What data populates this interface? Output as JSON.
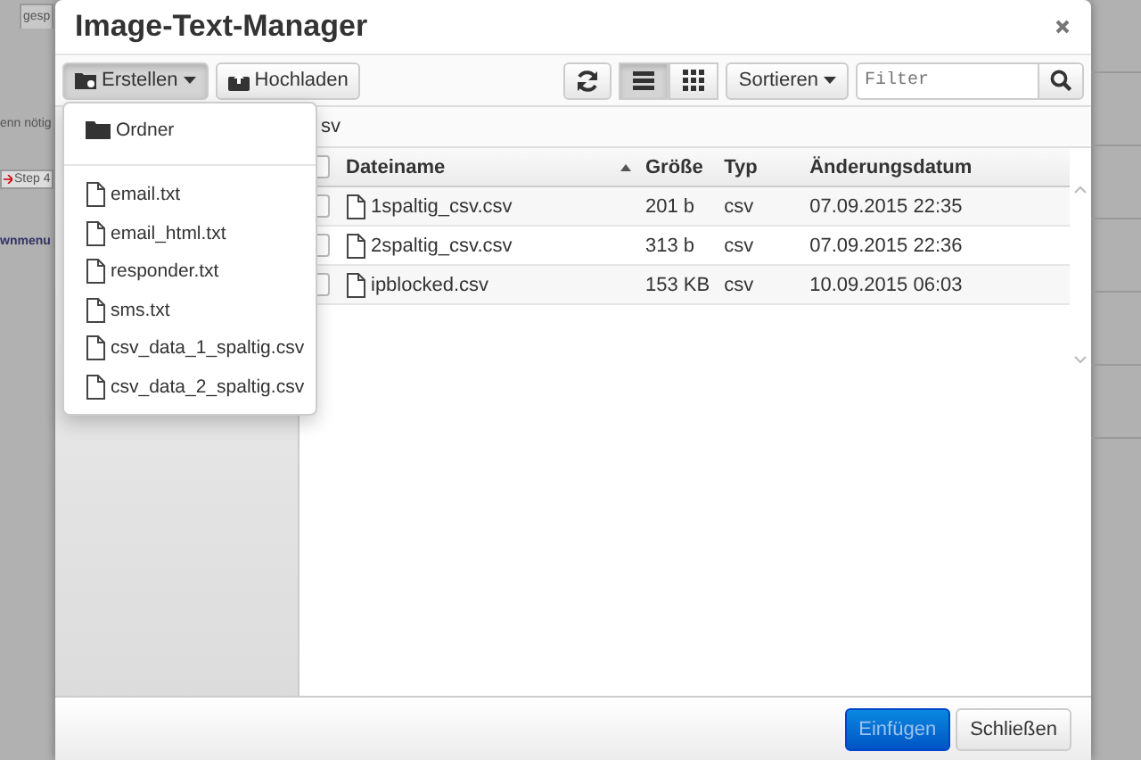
{
  "background": {
    "tab": "gesp",
    "texts": [
      {
        "kind": "hint",
        "text": "enn nötig"
      },
      {
        "kind": "step",
        "text": "Step 4"
      },
      {
        "kind": "link",
        "text": "wnmenu"
      }
    ]
  },
  "window": {
    "title": "Image-Text-Manager"
  },
  "toolbar": {
    "create_button": "Erstellen",
    "upload_button": "Hochladen",
    "views": [
      {
        "kind": "list",
        "selected": true
      },
      {
        "kind": "grid",
        "selected": false
      }
    ],
    "sort_button": "Sortieren",
    "filter": {
      "placeholder": "Filter"
    }
  },
  "create_menu": {
    "items": [
      {
        "kind": "folder",
        "label": "Ordner"
      },
      {
        "kind": "divider"
      },
      {
        "kind": "file",
        "label": "email.txt"
      },
      {
        "kind": "file",
        "label": "email_html.txt"
      },
      {
        "kind": "file",
        "label": "responder.txt"
      },
      {
        "kind": "file",
        "label": "sms.txt"
      },
      {
        "kind": "file",
        "label": "csv_data_1_spaltig.csv"
      },
      {
        "kind": "file",
        "label": "csv_data_2_spaltig.csv"
      }
    ]
  },
  "breadcrumb": "sv",
  "table": {
    "select_all_checked": false,
    "columns": [
      {
        "label": "Dateiname",
        "sorted": true
      },
      {
        "label": "Größe",
        "sorted": false
      },
      {
        "label": "Typ",
        "sorted": false
      },
      {
        "label": "Änderungsdatum",
        "sorted": false
      }
    ],
    "rows": [
      {
        "name": "1spaltig_csv.csv",
        "size": "201 b",
        "type": "csv",
        "modified": "07.09.2015 22:35",
        "checked": false
      },
      {
        "name": "2spaltig_csv.csv",
        "size": "313 b",
        "type": "csv",
        "modified": "07.09.2015 22:36",
        "checked": false
      },
      {
        "name": "ipblocked.csv",
        "size": "153 KB",
        "type": "csv",
        "modified": "10.09.2015 06:03",
        "checked": false
      }
    ]
  },
  "footer": {
    "buttons": [
      {
        "kind": "primary",
        "label": "Einfügen",
        "disabled": true
      },
      {
        "kind": "default",
        "label": "Schließen",
        "disabled": false
      }
    ]
  }
}
